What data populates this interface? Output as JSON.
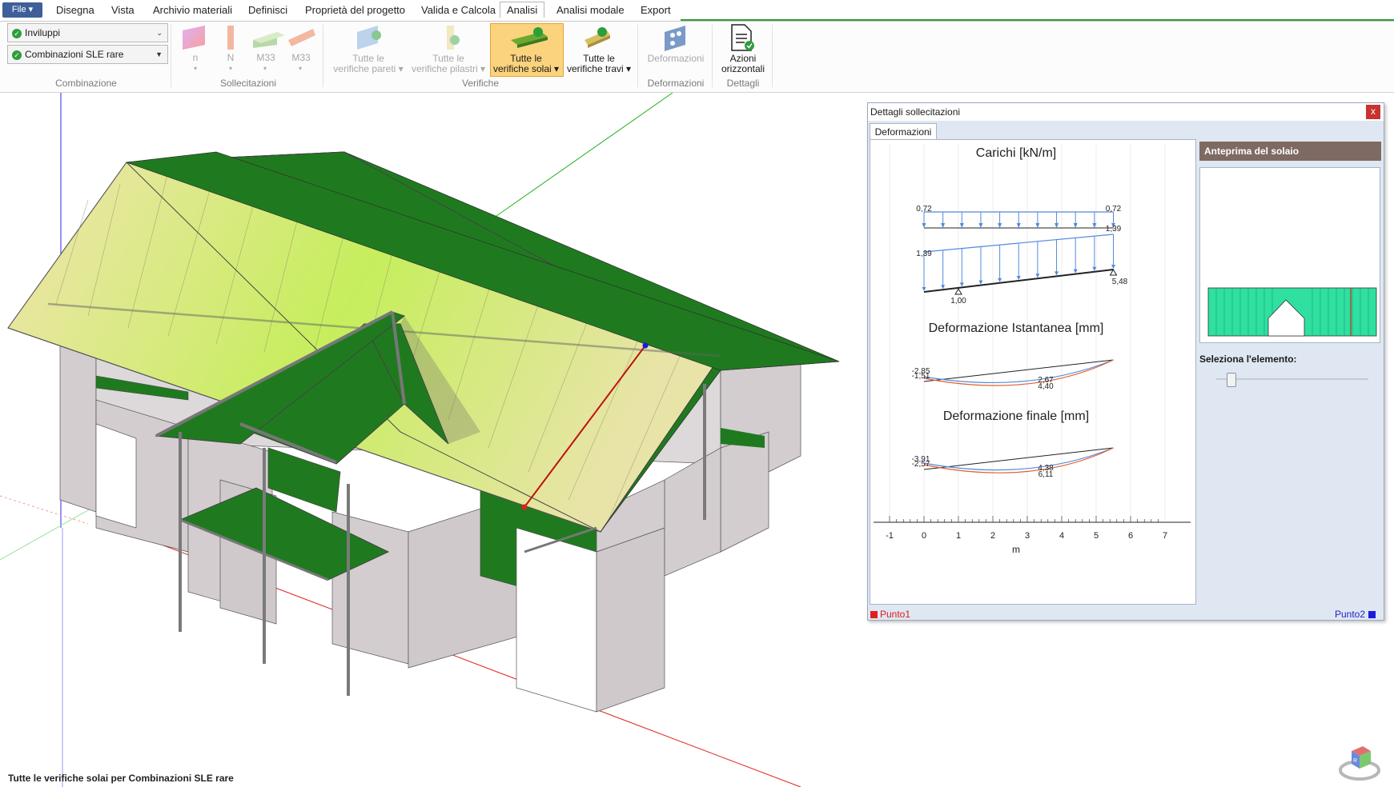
{
  "menu": {
    "file": "File",
    "tabs": [
      "Disegna",
      "Vista",
      "Archivio materiali",
      "Definisci",
      "Proprietà del progetto",
      "Valida e Calcola",
      "Analisi",
      "Analisi modale",
      "Export"
    ],
    "active_tab": "Analisi"
  },
  "ribbon": {
    "combinazione": {
      "combo1": "Inviluppi",
      "combo2": "Combinazioni SLE rare",
      "label": "Combinazione"
    },
    "sollecitazioni": {
      "buttons": [
        "n",
        "N",
        "M33",
        "M33"
      ],
      "label": "Sollecitazioni"
    },
    "verifiche": {
      "pareti": [
        "Tutte le",
        "verifiche pareti"
      ],
      "pilastri": [
        "Tutte le",
        "verifiche pilastri"
      ],
      "solai": [
        "Tutte le",
        "verifiche solai"
      ],
      "travi": [
        "Tutte le",
        "verifiche travi"
      ],
      "label": "Verifiche"
    },
    "deformazioni": {
      "button": "Deformazioni",
      "label": "Deformazioni"
    },
    "dettagli": {
      "button": [
        "Azioni",
        "orizzontali"
      ],
      "label": "Dettagli"
    }
  },
  "panel": {
    "title": "Dettagli sollecitazioni",
    "close": "x",
    "tab": "Deformazioni",
    "preview_title": "Anteprima del solaio",
    "select_label": "Seleziona l'elemento:",
    "legend": {
      "p1": "Punto1",
      "p2": "Punto2"
    },
    "colors": {
      "p1": "#e02020",
      "p2": "#1a1ae0"
    }
  },
  "chart_data": {
    "type": "line",
    "xlabel": "m",
    "xlim": [
      -1,
      7
    ],
    "ticks": [
      "-1",
      "0",
      "1",
      "2",
      "3",
      "4",
      "5",
      "6",
      "7"
    ],
    "sections": [
      {
        "title": "Carichi [kN/m]",
        "labels": [
          "0,72",
          "0,72",
          "1,39",
          "1,39",
          "1,00",
          "5,48"
        ]
      },
      {
        "title": "Deformazione Istantanea [mm]",
        "labels": [
          "-2,85",
          "-1,51",
          "2,67",
          "4,40"
        ]
      },
      {
        "title": "Deformazione finale [mm]",
        "labels": [
          "-3,91",
          "-2,57",
          "4,38",
          "6,11"
        ]
      }
    ]
  },
  "status_text": "Tutte le verifiche solai per Combinazioni SLE rare",
  "colors": {
    "roof_green": "#1f7a1f",
    "wall": "#d3cdd0",
    "accent_orange": "#fbd37d"
  }
}
